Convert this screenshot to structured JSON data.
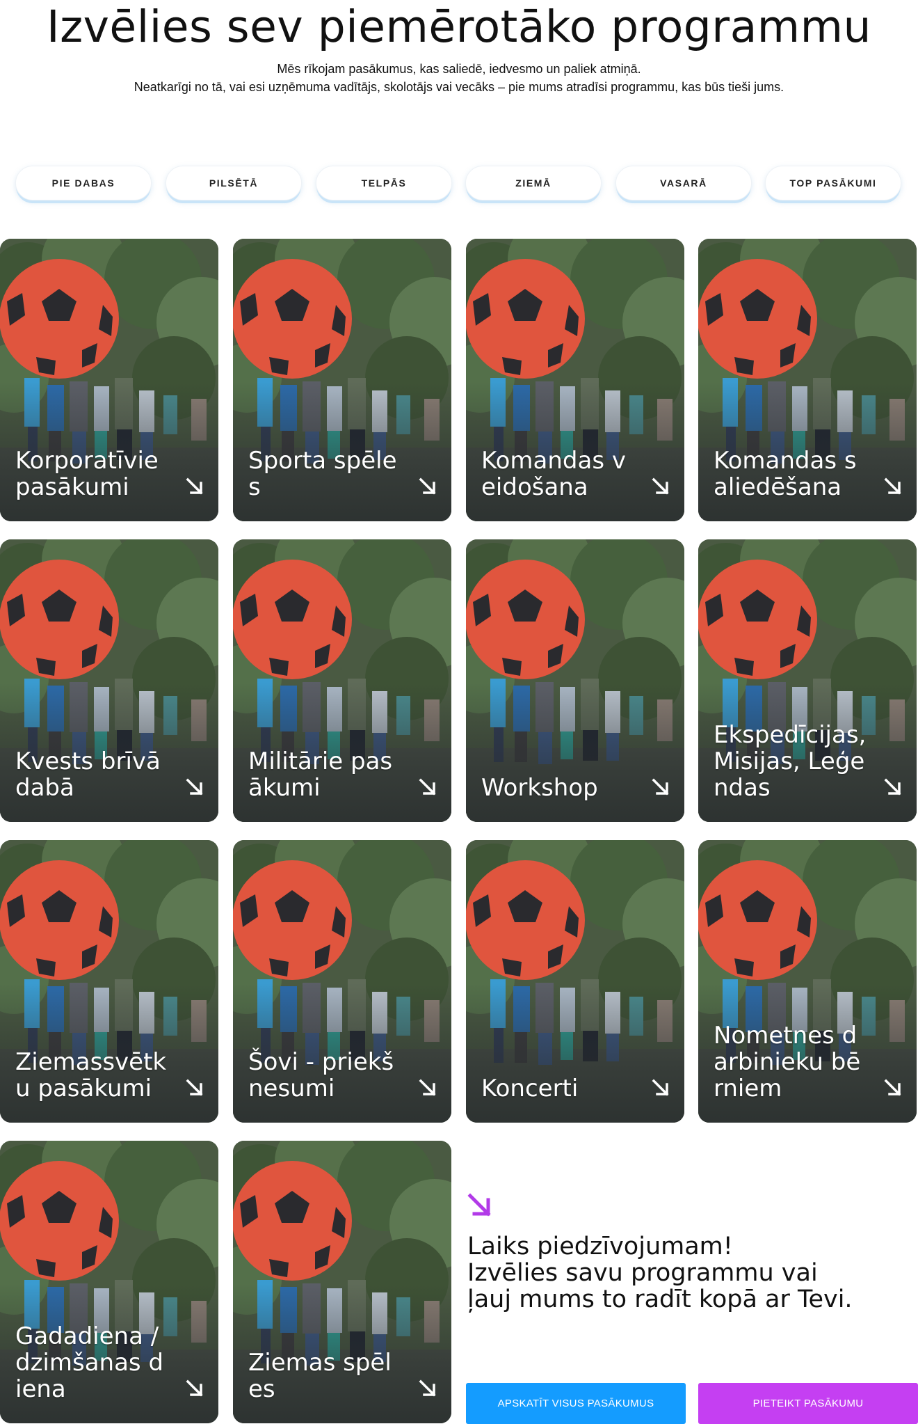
{
  "heading": {
    "title": "Izvēlies sev piemērotāko programmu",
    "line1": "Mēs rīkojam pasākumus, kas saliedē, iedvesmo un paliek atmiņā.",
    "line2": "Neatkarīgi no tā, vai esi uzņēmuma vadītājs, skolotājs vai vecāks – pie mums atradīsi programmu, kas būs tieši jums."
  },
  "filters": [
    "PIE DABAS",
    "PILSĒTĀ",
    "TELPĀS",
    "ZIEMĀ",
    "VASARĀ",
    "TOP PASĀKUMI"
  ],
  "cards": [
    {
      "name": "card-korporativie-pasakumi",
      "label": "Korporatīvie pasākumi"
    },
    {
      "name": "card-sporta-speles",
      "label": "Sporta spēles"
    },
    {
      "name": "card-komandas-veidosana",
      "label": "Komandas veidošana"
    },
    {
      "name": "card-komandas-saliedesana",
      "label": "Komandas saliedēšana"
    },
    {
      "name": "card-kvests-briva-daba",
      "label": "Kvests brīvā dabā"
    },
    {
      "name": "card-militarie-pasakumi",
      "label": "Militārie pasākumi"
    },
    {
      "name": "card-workshop",
      "label": "Workshop"
    },
    {
      "name": "card-ekspedicijas",
      "label": "Ekspedīcijas, Misijas, Leģendas"
    },
    {
      "name": "card-ziemassvetku-pasakumi",
      "label": "Ziemassvētku pasākumi"
    },
    {
      "name": "card-sovi-prieksnesumi",
      "label": "Šovi - priekšnesumi"
    },
    {
      "name": "card-koncerti",
      "label": "Koncerti"
    },
    {
      "name": "card-nometnes",
      "label": "Nometnes darbinieku bērniem"
    },
    {
      "name": "card-gadadiena",
      "label": "Gadadiena / dzimšanas diena"
    },
    {
      "name": "card-ziemas-speles",
      "label": "Ziemas spēles"
    }
  ],
  "cta": {
    "line1": "Laiks piedzīvojumam!",
    "line2": "Izvēlies savu programmu vai",
    "line3": "ļauj mums to radīt kopā ar Tevi.",
    "button_all": "APSKATĪT VISUS PASĀKUMUS",
    "button_apply": "PIETEIKT PASĀKUMU"
  },
  "colors": {
    "accent_blue": "#149cff",
    "accent_purple": "#c53ff2",
    "arrow_purple": "#b23ae8"
  }
}
